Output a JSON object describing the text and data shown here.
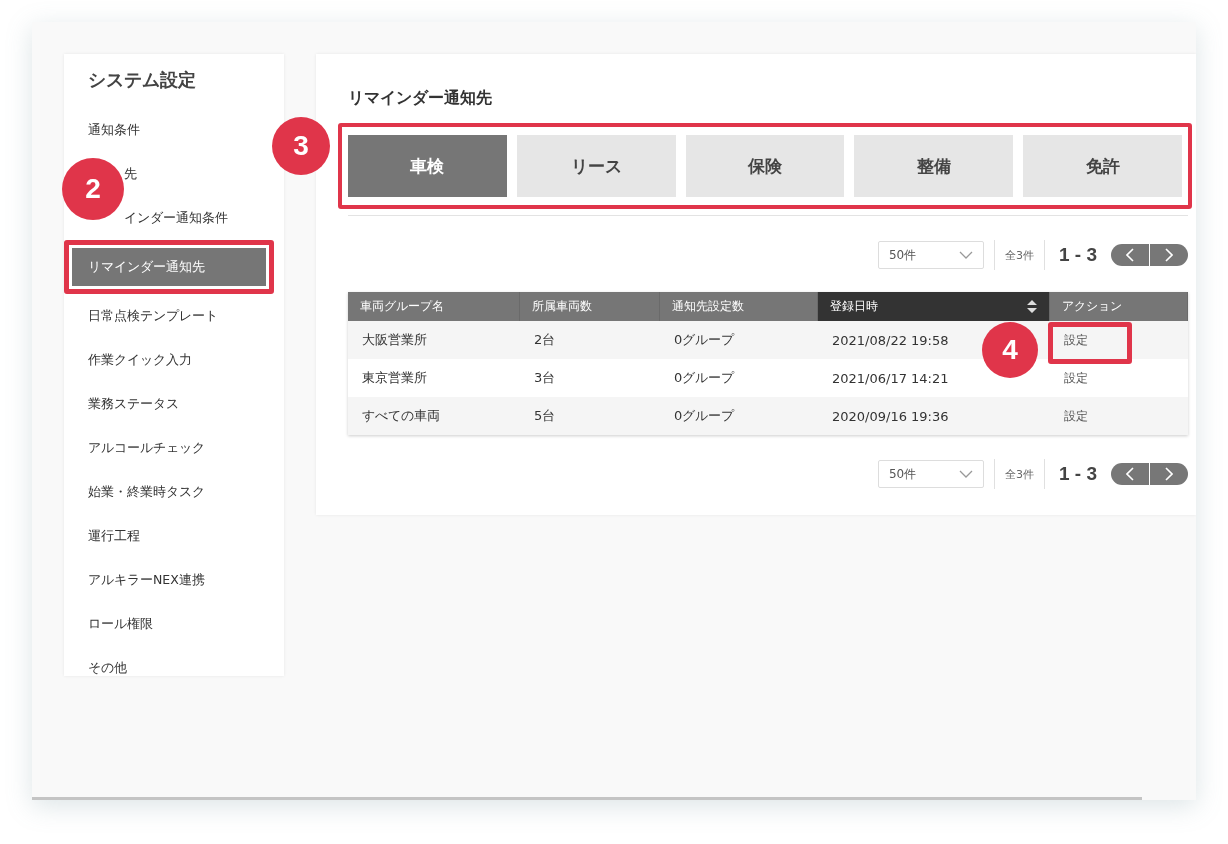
{
  "sidebar": {
    "title": "システム設定",
    "items": [
      {
        "label": "通知条件",
        "selected": false,
        "kind": "full"
      },
      {
        "label": "先",
        "selected": false,
        "kind": "partial"
      },
      {
        "label": "インダー通知条件",
        "selected": false,
        "kind": "partial"
      },
      {
        "label": "リマインダー通知先",
        "selected": true,
        "kind": "full"
      },
      {
        "label": "日常点検テンプレート",
        "selected": false,
        "kind": "full"
      },
      {
        "label": "作業クイック入力",
        "selected": false,
        "kind": "full"
      },
      {
        "label": "業務ステータス",
        "selected": false,
        "kind": "full"
      },
      {
        "label": "アルコールチェック",
        "selected": false,
        "kind": "full"
      },
      {
        "label": "始業・終業時タスク",
        "selected": false,
        "kind": "full"
      },
      {
        "label": "運行工程",
        "selected": false,
        "kind": "full"
      },
      {
        "label": "アルキラーNEX連携",
        "selected": false,
        "kind": "full"
      },
      {
        "label": "ロール権限",
        "selected": false,
        "kind": "full"
      },
      {
        "label": "その他",
        "selected": false,
        "kind": "full"
      }
    ]
  },
  "main": {
    "title": "リマインダー通知先",
    "tabs": [
      {
        "label": "車検",
        "selected": true
      },
      {
        "label": "リース",
        "selected": false
      },
      {
        "label": "保険",
        "selected": false
      },
      {
        "label": "整備",
        "selected": false
      },
      {
        "label": "免許",
        "selected": false
      }
    ],
    "pagination_top": {
      "per_page": "50件",
      "total": "全3件",
      "range": "1 - 3"
    },
    "table": {
      "columns": [
        {
          "label": "車両グループ名",
          "sorted": false
        },
        {
          "label": "所属車両数",
          "sorted": false
        },
        {
          "label": "通知先設定数",
          "sorted": false
        },
        {
          "label": "登録日時",
          "sorted": true
        },
        {
          "label": "アクション",
          "sorted": false
        }
      ],
      "rows": [
        [
          "大阪営業所",
          "2台",
          "0グループ",
          "2021/08/22 19:58",
          "設定"
        ],
        [
          "東京営業所",
          "3台",
          "0グループ",
          "2021/06/17 14:21",
          "設定"
        ],
        [
          "すべての車両",
          "5台",
          "0グループ",
          "2020/09/16 19:36",
          "設定"
        ]
      ]
    },
    "pagination_bottom": {
      "per_page": "50件",
      "total": "全3件",
      "range": "1 - 3"
    }
  },
  "callouts": [
    "2",
    "3",
    "4"
  ]
}
